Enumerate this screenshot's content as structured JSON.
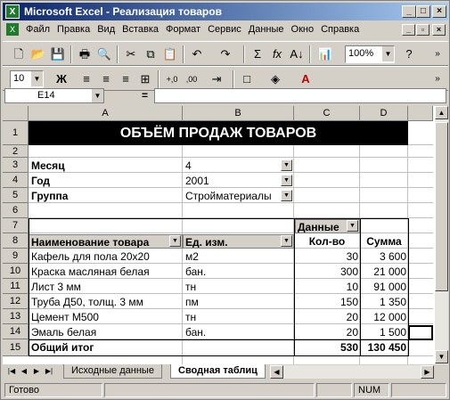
{
  "window": {
    "title": "Microsoft Excel - Реализация товаров"
  },
  "menu": [
    "Файл",
    "Правка",
    "Вид",
    "Вставка",
    "Формат",
    "Сервис",
    "Данные",
    "Окно",
    "Справка"
  ],
  "toolbar": {
    "zoom": "100%",
    "font_size": "10",
    "bold_label": "Ж"
  },
  "formula_bar": {
    "name_box": "E14",
    "equals": "="
  },
  "columns": [
    "A",
    "B",
    "C",
    "D"
  ],
  "rows": [
    "1",
    "2",
    "3",
    "4",
    "5",
    "6",
    "7",
    "8",
    "9",
    "10",
    "11",
    "12",
    "13",
    "14",
    "15"
  ],
  "sheet": {
    "title": "ОБЪЁМ ПРОДАЖ ТОВАРОВ",
    "filters": [
      {
        "label": "Месяц",
        "value": "4"
      },
      {
        "label": "Год",
        "value": "2001"
      },
      {
        "label": "Группа",
        "value": "Стройматериалы"
      }
    ],
    "data_header": "Данные",
    "headers": {
      "name": "Наименование товара",
      "unit": "Ед. изм.",
      "qty": "Кол-во",
      "sum": "Сумма"
    },
    "items": [
      {
        "name": "Кафель для пола 20х20",
        "unit": "м2",
        "qty": "30",
        "sum": "3 600"
      },
      {
        "name": "Краска масляная белая",
        "unit": "бан.",
        "qty": "300",
        "sum": "21 000"
      },
      {
        "name": "Лист 3 мм",
        "unit": "тн",
        "qty": "10",
        "sum": "91 000"
      },
      {
        "name": "Труба Д50, толщ. 3 мм",
        "unit": "пм",
        "qty": "150",
        "sum": "1 350"
      },
      {
        "name": "Цемент М500",
        "unit": "тн",
        "qty": "20",
        "sum": "12 000"
      },
      {
        "name": "Эмаль белая",
        "unit": "бан.",
        "qty": "20",
        "sum": "1 500"
      }
    ],
    "total": {
      "label": "Общий итог",
      "qty": "530",
      "sum": "130 450"
    }
  },
  "tabs": [
    {
      "label": "Исходные данные",
      "active": false
    },
    {
      "label": "Сводная таблиц",
      "active": true
    }
  ],
  "status": {
    "ready": "Готово",
    "num": "NUM"
  }
}
